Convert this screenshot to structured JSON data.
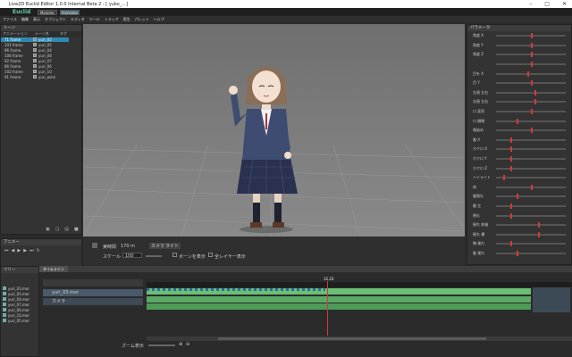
{
  "app": {
    "title": "Live2D Euclid Editor 1.0.0 Internal Beta 2 - [ yuko_...]",
    "brand": "Euclid",
    "modes": [
      "Modeler",
      "Animator"
    ],
    "menu": [
      "ファイル",
      "編集",
      "表示",
      "オブジェクト",
      "エディタ",
      "ツール",
      "トラック",
      "再生",
      "パレット",
      "ヘルプ"
    ]
  },
  "scene": {
    "panel_title": "シーン",
    "col_a": "アニメーション",
    "col_b": "シーン名",
    "col_c": "タグ",
    "rows": [
      {
        "a": "71 frame",
        "b": "yuri_03",
        "sel": true
      },
      {
        "a": "101 frame",
        "b": "yuri_05",
        "sel": false
      },
      {
        "a": "96 frame",
        "b": "yuri_04",
        "sel": false
      },
      {
        "a": "106 frame",
        "b": "yuri_08",
        "sel": false
      },
      {
        "a": "92 frame",
        "b": "yuri_07",
        "sel": false
      },
      {
        "a": "86 frame",
        "b": "yuri_06",
        "sel": false
      },
      {
        "a": "102 frame",
        "b": "yuri_10",
        "sel": false
      },
      {
        "a": "91 frame",
        "b": "yuri_wink",
        "sel": false
      }
    ]
  },
  "anim_panel": {
    "title": "アニメー"
  },
  "viewport_bar": {
    "fps_label": "実時間",
    "fps_value": "170 m",
    "scale_label": "スケール",
    "scale_value": "100",
    "check1": "ボーンを表示",
    "check2": "全レイヤー表示",
    "btn1": "カメラ",
    "btn2": "ライト"
  },
  "properties": {
    "title": "パラメータ",
    "rows": [
      {
        "label": "角度 X",
        "value": 0.5
      },
      {
        "label": "角度 Y",
        "value": 0.5
      },
      {
        "label": "角度 Z",
        "value": 0.5
      },
      {
        "label": "",
        "value": 0.5
      },
      {
        "label": "目を X",
        "value": 0.45
      },
      {
        "label": "目 Y",
        "value": 0.5
      },
      {
        "label": "左眉 左右",
        "value": 0.55
      },
      {
        "label": "右眉 左右",
        "value": 0.55
      },
      {
        "label": "口 変形",
        "value": 0.5
      },
      {
        "label": "口 開閉",
        "value": 0.3
      },
      {
        "label": "頬染め",
        "value": 0.5
      },
      {
        "label": "腕 X",
        "value": 0.2
      },
      {
        "label": "ホクロ X",
        "value": 0.2
      },
      {
        "label": "ホクロ Y",
        "value": 0.2
      },
      {
        "label": "ホクロ Z",
        "value": 0.2
      },
      {
        "label": "ハイライト",
        "value": 0.1
      },
      {
        "label": "体",
        "value": 0.5
      },
      {
        "label": "髪揺れ",
        "value": 0.3
      },
      {
        "label": "腕 左",
        "value": 0.2
      },
      {
        "label": "揺れ",
        "value": 0.2
      },
      {
        "label": "揺れ 前後",
        "value": 0.6
      },
      {
        "label": "揺れ 横",
        "value": 0.6
      },
      {
        "label": "胸 揺れ",
        "value": 0.2
      },
      {
        "label": "髪 揺れ",
        "value": 0.3
      }
    ]
  },
  "tree": {
    "title": "ツリー",
    "items": [
      "yuri_03.mor",
      "yuri_05.mor",
      "yuri_04.mor",
      "yuri_07.mor",
      "yuri_06.mor",
      "yuri_10.mor",
      "yuri_05.mor"
    ]
  },
  "timeline": {
    "title": "タイムライン",
    "tracks": [
      "yuri_03.mor",
      "カメラ"
    ],
    "cursor_label": "12.23",
    "zoom_label": "ズーム表示"
  },
  "colors": {
    "accent": "#2e8ab0",
    "track_green": "#5fbf6a",
    "cursor_red": "#d43a3a"
  }
}
